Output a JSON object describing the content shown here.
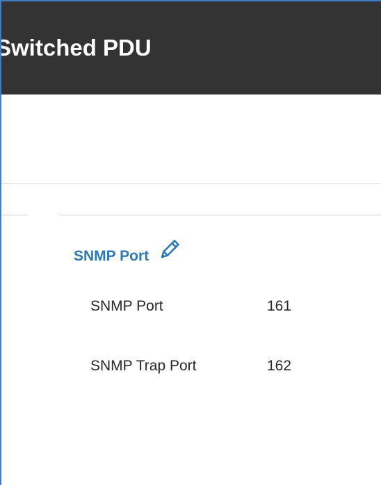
{
  "header": {
    "title": "Switched PDU"
  },
  "snmp_port_section": {
    "title": "SNMP Port",
    "edit_icon": "pencil-icon",
    "rows": [
      {
        "label": "SNMP Port",
        "value": "161"
      },
      {
        "label": "SNMP Trap Port",
        "value": "162"
      }
    ]
  },
  "colors": {
    "header_bg": "#333333",
    "header_text": "#ffffff",
    "accent": "#2a7ab8",
    "window_border": "#3d7cc9",
    "body_text": "#262626",
    "divider": "#d9d9d9"
  }
}
